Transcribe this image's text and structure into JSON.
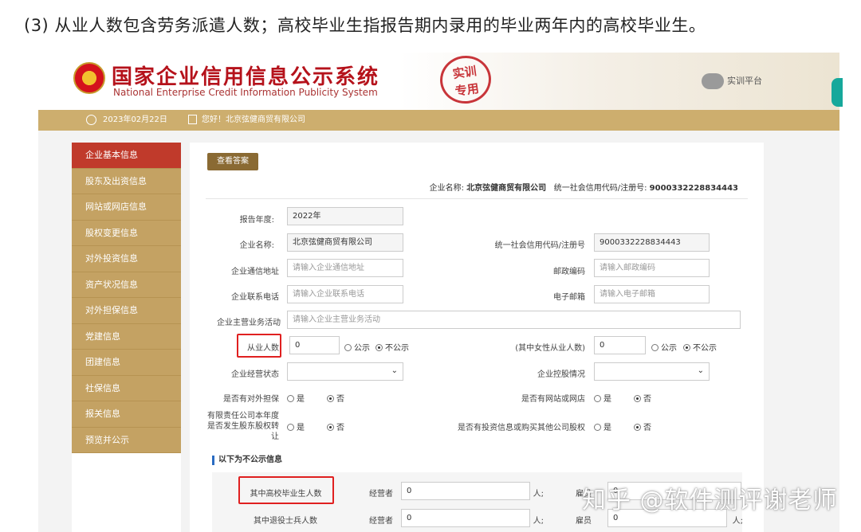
{
  "note": "(3) 从业人数包含劳务派遣人数；高校毕业生指报告期内录用的毕业两年内的高校毕业生。",
  "header": {
    "title": "国家企业信用信息公示系统",
    "subtitle": "National Enterprise Credit Information Publicity System",
    "stamp": "实训专用",
    "training": "实训平台"
  },
  "infobar": {
    "date": "2023年02月22日",
    "greeting": "您好！北京弦健商贸有限公司"
  },
  "sidebar": {
    "items": [
      "企业基本信息",
      "股东及出资信息",
      "网站或网店信息",
      "股权变更信息",
      "对外投资信息",
      "资产状况信息",
      "对外担保信息",
      "党建信息",
      "团建信息",
      "社保信息",
      "报关信息",
      "预览并公示"
    ]
  },
  "main": {
    "archive_button": "查看答案",
    "company_label": "企业名称:",
    "company_name": "北京弦健商贸有限公司",
    "credit_label": "统一社会信用代码/注册号:",
    "credit_code": "9000332228834443",
    "form": {
      "year_label": "报告年度:",
      "year": "2022年",
      "name_label": "企业名称:",
      "name": "北京弦健商贸有限公司",
      "code_label": "统一社会信用代码/注册号",
      "code": "9000332228834443",
      "addr_label": "企业通信地址",
      "addr_ph": "请输入企业通信地址",
      "zip_label": "邮政编码",
      "zip_ph": "请输入邮政编码",
      "phone_label": "企业联系电话",
      "phone_ph": "请输入企业联系电话",
      "email_label": "电子邮箱",
      "email_ph": "请输入电子邮箱",
      "biz_label": "企业主营业务活动",
      "biz_ph": "请输入企业主营业务活动",
      "staff_label": "从业人数",
      "staff": "0",
      "public": "公示",
      "not_public": "不公示",
      "female_label": "(其中女性从业人数)",
      "female": "0",
      "status_label": "企业经营状态",
      "control_label": "企业控股情况",
      "guarantee_label": "是否有对外担保",
      "yes": "是",
      "no": "否",
      "website_label": "是否有网站或网店",
      "equity_label": "有限责任公司本年度是否发生股东股权转让",
      "invest_label": "是否有投资信息或购买其他公司股权"
    },
    "section_title": "以下为不公示信息",
    "table": {
      "grad_label": "其中高校毕业生人数",
      "veteran_label": "其中退役士兵人数",
      "operator": "经营者",
      "employee": "雇员",
      "unit": "人;",
      "v1": "0",
      "v2": "0",
      "v3": "0",
      "v4": "0"
    }
  },
  "watermark": "知乎 @软件测评谢老师"
}
